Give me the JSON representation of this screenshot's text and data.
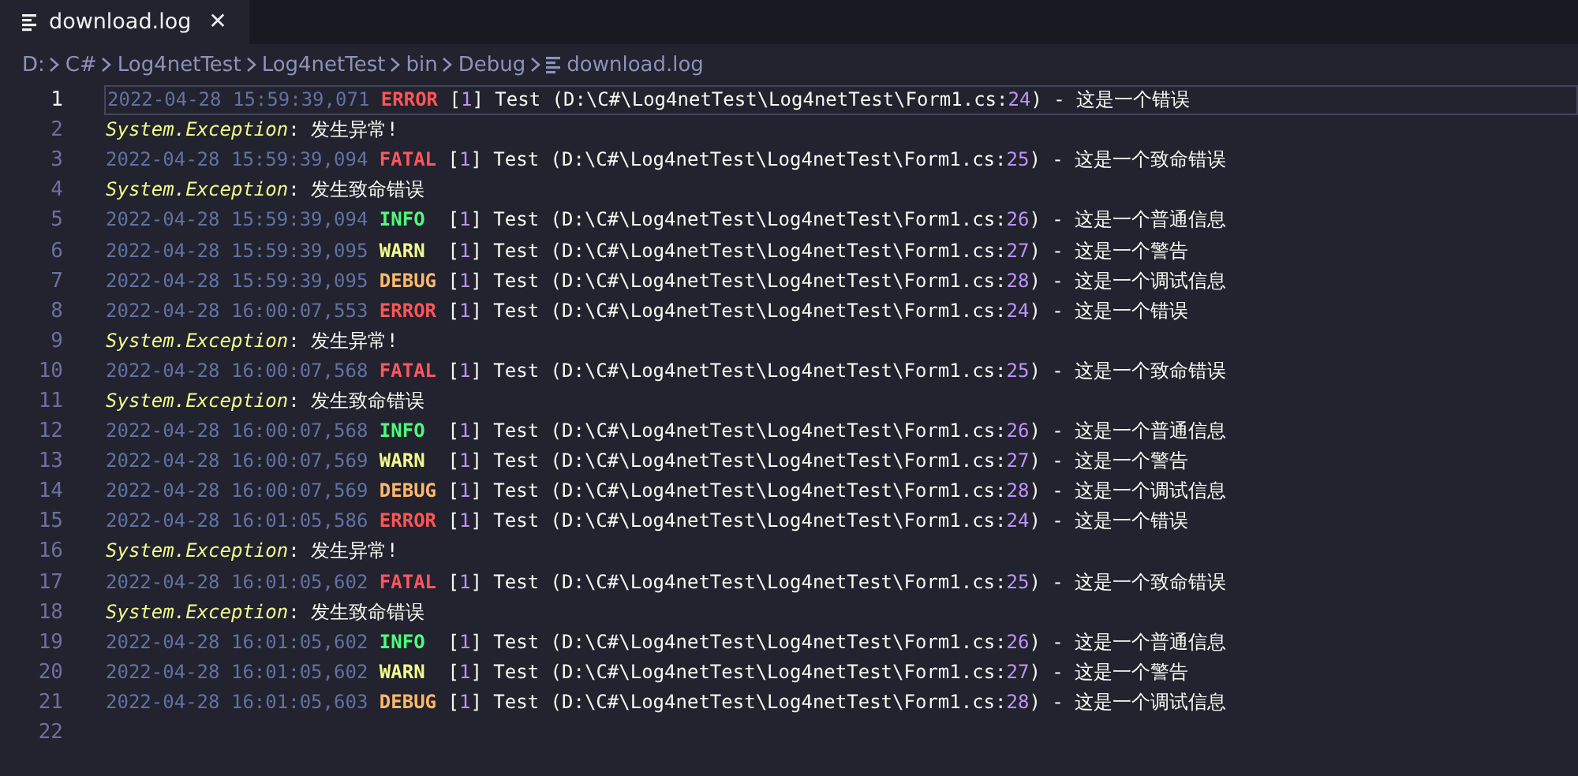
{
  "tab": {
    "title": "download.log",
    "selected": true,
    "close": "✕"
  },
  "breadcrumb": [
    {
      "label": "D:",
      "kind": "folder"
    },
    {
      "label": "C#",
      "kind": "folder"
    },
    {
      "label": "Log4netTest",
      "kind": "folder"
    },
    {
      "label": "Log4netTest",
      "kind": "folder"
    },
    {
      "label": "bin",
      "kind": "folder"
    },
    {
      "label": "Debug",
      "kind": "folder"
    },
    {
      "label": "download.log",
      "kind": "file"
    }
  ],
  "lines": [
    {
      "number": "1",
      "current": true,
      "tokens": [
        {
          "kind": "time",
          "text": "2022-04-28 15:59:39,071"
        },
        {
          "kind": "error",
          "text": "ERROR"
        },
        {
          "kind": "plain",
          "text": " ["
        },
        {
          "kind": "number",
          "text": "1"
        },
        {
          "kind": "plain",
          "text": "] Test (D:\\C#\\Log4netTest\\Log4netTest\\Form1.cs:"
        },
        {
          "kind": "number",
          "text": "24"
        },
        {
          "kind": "plain",
          "text": ") - 这是一个错误"
        }
      ]
    },
    {
      "number": "2",
      "current": false,
      "tokens": [
        {
          "kind": "exception",
          "text": "System.Exception"
        },
        {
          "kind": "plain",
          "text": ": 发生异常!"
        }
      ]
    },
    {
      "number": "3",
      "current": false,
      "tokens": [
        {
          "kind": "time",
          "text": "2022-04-28 15:59:39,094"
        },
        {
          "kind": "fatal",
          "text": "FATAL"
        },
        {
          "kind": "plain",
          "text": " ["
        },
        {
          "kind": "number",
          "text": "1"
        },
        {
          "kind": "plain",
          "text": "] Test (D:\\C#\\Log4netTest\\Log4netTest\\Form1.cs:"
        },
        {
          "kind": "number",
          "text": "25"
        },
        {
          "kind": "plain",
          "text": ") - 这是一个致命错误"
        }
      ]
    },
    {
      "number": "4",
      "current": false,
      "tokens": [
        {
          "kind": "exception",
          "text": "System.Exception"
        },
        {
          "kind": "plain",
          "text": ": 发生致命错误"
        }
      ]
    },
    {
      "number": "5",
      "current": false,
      "tokens": [
        {
          "kind": "time",
          "text": "2022-04-28 15:59:39,094"
        },
        {
          "kind": "info",
          "text": "INFO"
        },
        {
          "kind": "plain",
          "text": "  ["
        },
        {
          "kind": "number",
          "text": "1"
        },
        {
          "kind": "plain",
          "text": "] Test (D:\\C#\\Log4netTest\\Log4netTest\\Form1.cs:"
        },
        {
          "kind": "number",
          "text": "26"
        },
        {
          "kind": "plain",
          "text": ") - 这是一个普通信息"
        }
      ]
    },
    {
      "number": "6",
      "current": false,
      "tokens": [
        {
          "kind": "time",
          "text": "2022-04-28 15:59:39,095"
        },
        {
          "kind": "warn",
          "text": "WARN"
        },
        {
          "kind": "plain",
          "text": "  ["
        },
        {
          "kind": "number",
          "text": "1"
        },
        {
          "kind": "plain",
          "text": "] Test (D:\\C#\\Log4netTest\\Log4netTest\\Form1.cs:"
        },
        {
          "kind": "number",
          "text": "27"
        },
        {
          "kind": "plain",
          "text": ") - 这是一个警告"
        }
      ]
    },
    {
      "number": "7",
      "current": false,
      "tokens": [
        {
          "kind": "time",
          "text": "2022-04-28 15:59:39,095"
        },
        {
          "kind": "debug",
          "text": "DEBUG"
        },
        {
          "kind": "plain",
          "text": " ["
        },
        {
          "kind": "number",
          "text": "1"
        },
        {
          "kind": "plain",
          "text": "] Test (D:\\C#\\Log4netTest\\Log4netTest\\Form1.cs:"
        },
        {
          "kind": "number",
          "text": "28"
        },
        {
          "kind": "plain",
          "text": ") - 这是一个调试信息"
        }
      ]
    },
    {
      "number": "8",
      "current": false,
      "tokens": [
        {
          "kind": "time",
          "text": "2022-04-28 16:00:07,553"
        },
        {
          "kind": "error",
          "text": "ERROR"
        },
        {
          "kind": "plain",
          "text": " ["
        },
        {
          "kind": "number",
          "text": "1"
        },
        {
          "kind": "plain",
          "text": "] Test (D:\\C#\\Log4netTest\\Log4netTest\\Form1.cs:"
        },
        {
          "kind": "number",
          "text": "24"
        },
        {
          "kind": "plain",
          "text": ") - 这是一个错误"
        }
      ]
    },
    {
      "number": "9",
      "current": false,
      "tokens": [
        {
          "kind": "exception",
          "text": "System.Exception"
        },
        {
          "kind": "plain",
          "text": ": 发生异常!"
        }
      ]
    },
    {
      "number": "10",
      "current": false,
      "tokens": [
        {
          "kind": "time",
          "text": "2022-04-28 16:00:07,568"
        },
        {
          "kind": "fatal",
          "text": "FATAL"
        },
        {
          "kind": "plain",
          "text": " ["
        },
        {
          "kind": "number",
          "text": "1"
        },
        {
          "kind": "plain",
          "text": "] Test (D:\\C#\\Log4netTest\\Log4netTest\\Form1.cs:"
        },
        {
          "kind": "number",
          "text": "25"
        },
        {
          "kind": "plain",
          "text": ") - 这是一个致命错误"
        }
      ]
    },
    {
      "number": "11",
      "current": false,
      "tokens": [
        {
          "kind": "exception",
          "text": "System.Exception"
        },
        {
          "kind": "plain",
          "text": ": 发生致命错误"
        }
      ]
    },
    {
      "number": "12",
      "current": false,
      "tokens": [
        {
          "kind": "time",
          "text": "2022-04-28 16:00:07,568"
        },
        {
          "kind": "info",
          "text": "INFO"
        },
        {
          "kind": "plain",
          "text": "  ["
        },
        {
          "kind": "number",
          "text": "1"
        },
        {
          "kind": "plain",
          "text": "] Test (D:\\C#\\Log4netTest\\Log4netTest\\Form1.cs:"
        },
        {
          "kind": "number",
          "text": "26"
        },
        {
          "kind": "plain",
          "text": ") - 这是一个普通信息"
        }
      ]
    },
    {
      "number": "13",
      "current": false,
      "tokens": [
        {
          "kind": "time",
          "text": "2022-04-28 16:00:07,569"
        },
        {
          "kind": "warn",
          "text": "WARN"
        },
        {
          "kind": "plain",
          "text": "  ["
        },
        {
          "kind": "number",
          "text": "1"
        },
        {
          "kind": "plain",
          "text": "] Test (D:\\C#\\Log4netTest\\Log4netTest\\Form1.cs:"
        },
        {
          "kind": "number",
          "text": "27"
        },
        {
          "kind": "plain",
          "text": ") - 这是一个警告"
        }
      ]
    },
    {
      "number": "14",
      "current": false,
      "tokens": [
        {
          "kind": "time",
          "text": "2022-04-28 16:00:07,569"
        },
        {
          "kind": "debug",
          "text": "DEBUG"
        },
        {
          "kind": "plain",
          "text": " ["
        },
        {
          "kind": "number",
          "text": "1"
        },
        {
          "kind": "plain",
          "text": "] Test (D:\\C#\\Log4netTest\\Log4netTest\\Form1.cs:"
        },
        {
          "kind": "number",
          "text": "28"
        },
        {
          "kind": "plain",
          "text": ") - 这是一个调试信息"
        }
      ]
    },
    {
      "number": "15",
      "current": false,
      "tokens": [
        {
          "kind": "time",
          "text": "2022-04-28 16:01:05,586"
        },
        {
          "kind": "error",
          "text": "ERROR"
        },
        {
          "kind": "plain",
          "text": " ["
        },
        {
          "kind": "number",
          "text": "1"
        },
        {
          "kind": "plain",
          "text": "] Test (D:\\C#\\Log4netTest\\Log4netTest\\Form1.cs:"
        },
        {
          "kind": "number",
          "text": "24"
        },
        {
          "kind": "plain",
          "text": ") - 这是一个错误"
        }
      ]
    },
    {
      "number": "16",
      "current": false,
      "tokens": [
        {
          "kind": "exception",
          "text": "System.Exception"
        },
        {
          "kind": "plain",
          "text": ": 发生异常!"
        }
      ]
    },
    {
      "number": "17",
      "current": false,
      "tokens": [
        {
          "kind": "time",
          "text": "2022-04-28 16:01:05,602"
        },
        {
          "kind": "fatal",
          "text": "FATAL"
        },
        {
          "kind": "plain",
          "text": " ["
        },
        {
          "kind": "number",
          "text": "1"
        },
        {
          "kind": "plain",
          "text": "] Test (D:\\C#\\Log4netTest\\Log4netTest\\Form1.cs:"
        },
        {
          "kind": "number",
          "text": "25"
        },
        {
          "kind": "plain",
          "text": ") - 这是一个致命错误"
        }
      ]
    },
    {
      "number": "18",
      "current": false,
      "tokens": [
        {
          "kind": "exception",
          "text": "System.Exception"
        },
        {
          "kind": "plain",
          "text": ": 发生致命错误"
        }
      ]
    },
    {
      "number": "19",
      "current": false,
      "tokens": [
        {
          "kind": "time",
          "text": "2022-04-28 16:01:05,602"
        },
        {
          "kind": "info",
          "text": "INFO"
        },
        {
          "kind": "plain",
          "text": "  ["
        },
        {
          "kind": "number",
          "text": "1"
        },
        {
          "kind": "plain",
          "text": "] Test (D:\\C#\\Log4netTest\\Log4netTest\\Form1.cs:"
        },
        {
          "kind": "number",
          "text": "26"
        },
        {
          "kind": "plain",
          "text": ") - 这是一个普通信息"
        }
      ]
    },
    {
      "number": "20",
      "current": false,
      "tokens": [
        {
          "kind": "time",
          "text": "2022-04-28 16:01:05,602"
        },
        {
          "kind": "warn",
          "text": "WARN"
        },
        {
          "kind": "plain",
          "text": "  ["
        },
        {
          "kind": "number",
          "text": "1"
        },
        {
          "kind": "plain",
          "text": "] Test (D:\\C#\\Log4netTest\\Log4netTest\\Form1.cs:"
        },
        {
          "kind": "number",
          "text": "27"
        },
        {
          "kind": "plain",
          "text": ") - 这是一个警告"
        }
      ]
    },
    {
      "number": "21",
      "current": false,
      "tokens": [
        {
          "kind": "time",
          "text": "2022-04-28 16:01:05,603"
        },
        {
          "kind": "debug",
          "text": "DEBUG"
        },
        {
          "kind": "plain",
          "text": " ["
        },
        {
          "kind": "number",
          "text": "1"
        },
        {
          "kind": "plain",
          "text": "] Test (D:\\C#\\Log4netTest\\Log4netTest\\Form1.cs:"
        },
        {
          "kind": "number",
          "text": "28"
        },
        {
          "kind": "plain",
          "text": ") - 这是一个调试信息"
        }
      ]
    },
    {
      "number": "22",
      "current": false
    }
  ]
}
